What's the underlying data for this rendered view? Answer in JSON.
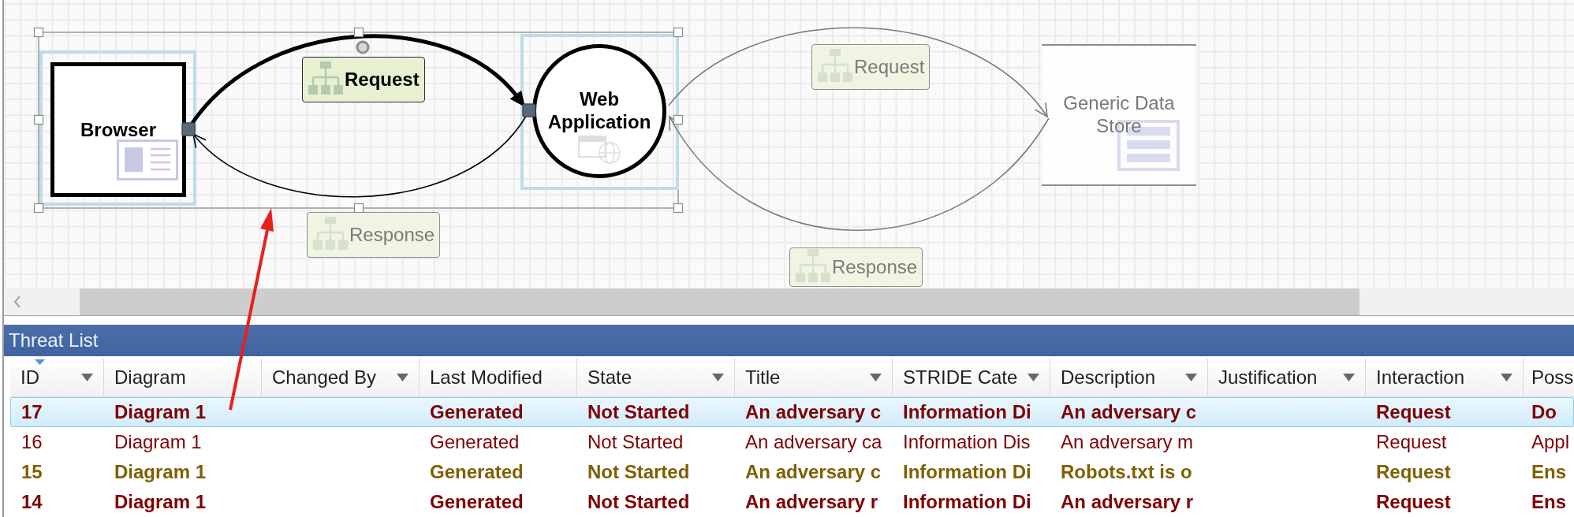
{
  "diagram": {
    "nodes": [
      {
        "label": "Browser",
        "kind": "external_interactor",
        "selected": true
      },
      {
        "label": "Web Application",
        "kind": "process",
        "selected": true
      },
      {
        "label": "Generic Data Store",
        "kind": "data_store",
        "selected": false
      }
    ],
    "flows": [
      {
        "label": "Request",
        "selected": true,
        "in_selection": true
      },
      {
        "label": "Response",
        "selected": false,
        "in_selection": true
      },
      {
        "label": "Request",
        "selected": false,
        "in_selection": false
      },
      {
        "label": "Response",
        "selected": false,
        "in_selection": false
      }
    ]
  },
  "threat_list": {
    "title": "Threat List",
    "columns": [
      {
        "label": "ID",
        "filter": true,
        "sorted": true
      },
      {
        "label": "Diagram",
        "filter": false,
        "sorted": false
      },
      {
        "label": "Changed By",
        "filter": true,
        "sorted": false
      },
      {
        "label": "Last Modified",
        "filter": false,
        "sorted": false
      },
      {
        "label": "State",
        "filter": true,
        "sorted": false
      },
      {
        "label": "Title",
        "filter": true,
        "sorted": false
      },
      {
        "label": "STRIDE Cate",
        "filter": true,
        "sorted": false
      },
      {
        "label": "Description",
        "filter": true,
        "sorted": false
      },
      {
        "label": "Justification",
        "filter": true,
        "sorted": false
      },
      {
        "label": "Interaction",
        "filter": true,
        "sorted": false
      },
      {
        "label": "Poss",
        "sorted": false
      }
    ],
    "rows": [
      {
        "cells": [
          "17",
          "Diagram 1",
          null,
          "Generated",
          "Not Started",
          "An adversary c",
          "Information Di",
          "An adversary c",
          null,
          "Request",
          "Do"
        ],
        "selected": true,
        "bold": true,
        "color": "#800000"
      },
      {
        "cells": [
          "16",
          "Diagram 1",
          null,
          "Generated",
          "Not Started",
          "An adversary ca",
          "Information Dis",
          "An adversary m",
          null,
          "Request",
          "Appl"
        ],
        "selected": false,
        "bold": false,
        "color": "#800000"
      },
      {
        "cells": [
          "15",
          "Diagram 1",
          null,
          "Generated",
          "Not Started",
          "An adversary c",
          "Information Di",
          "Robots.txt is o",
          null,
          "Request",
          "Ens"
        ],
        "selected": false,
        "bold": true,
        "color": "#7f6000"
      },
      {
        "cells": [
          "14",
          "Diagram 1",
          null,
          "Generated",
          "Not Started",
          "An adversary r",
          "Information Di",
          "An adversary r",
          null,
          "Request",
          "Ens"
        ],
        "selected": false,
        "bold": true,
        "color": "#800000"
      }
    ]
  }
}
